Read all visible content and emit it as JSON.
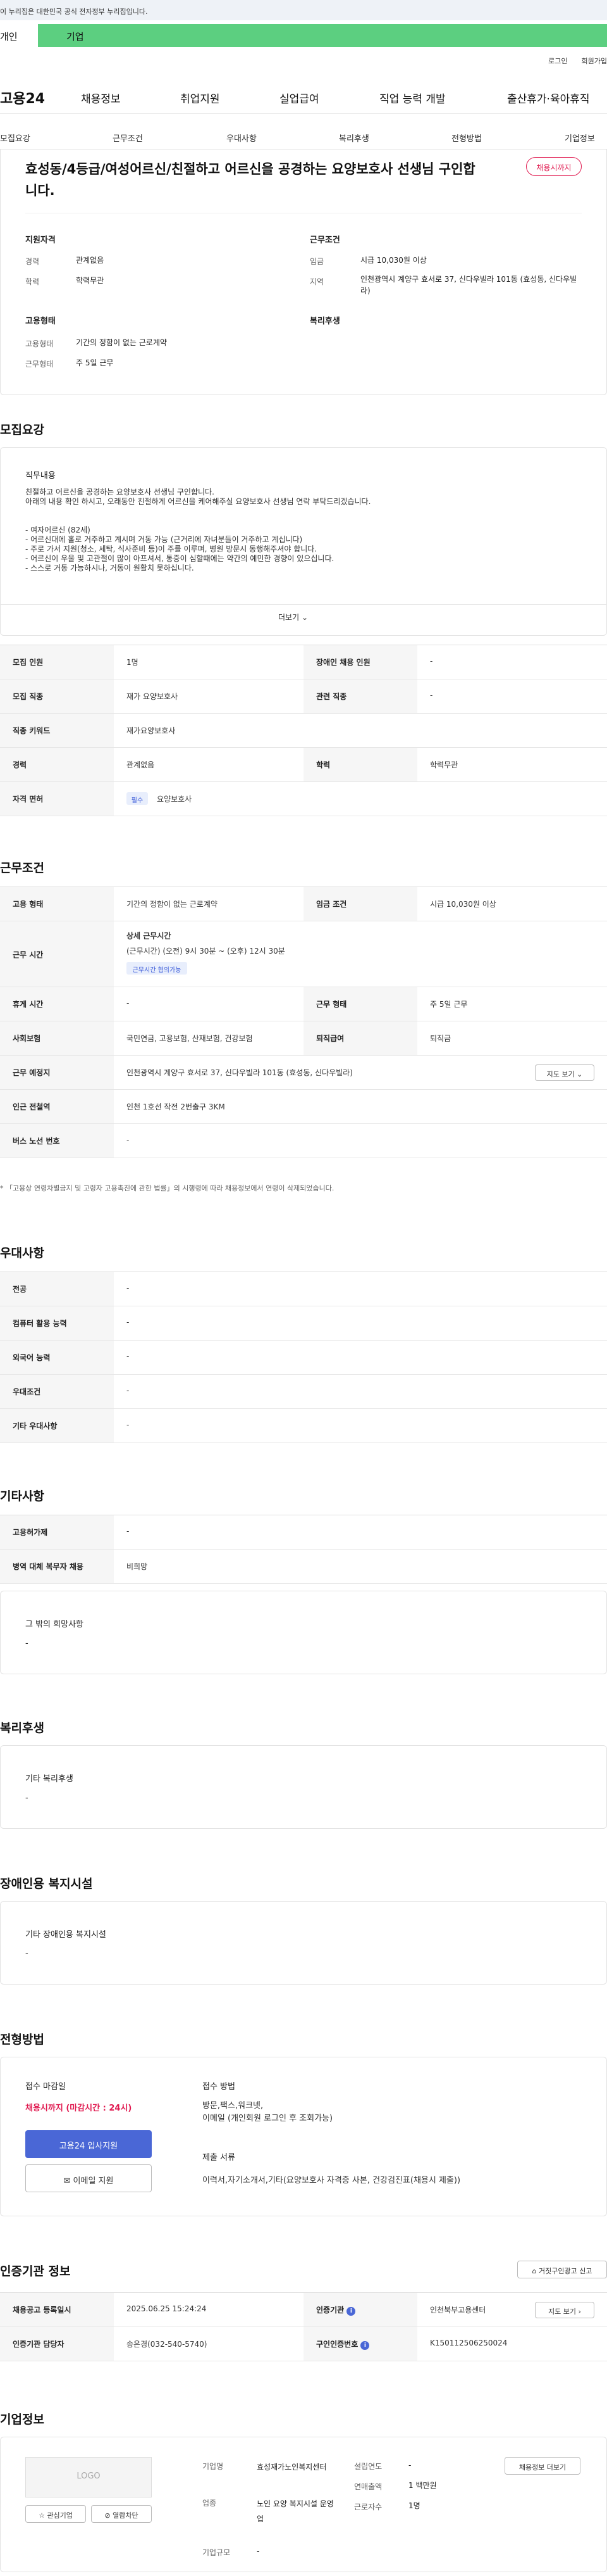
{
  "gov_bar": {
    "text": "이 누리집은 대한민국 공식 전자정부 누리집입니다."
  },
  "tabs": {
    "personal": "개인",
    "corporate": "기업"
  },
  "util": {
    "login": "로그인",
    "join": "회원가입"
  },
  "gnb": {
    "logo": "고용24",
    "menus": [
      "채용정보",
      "취업지원",
      "실업급여",
      "직업 능력 개발",
      "출산휴가·육아휴직"
    ]
  },
  "anchors": [
    "모집요강",
    "근무조건",
    "우대사항",
    "복리후생",
    "전형방법",
    "기업정보"
  ],
  "header": {
    "title": "효성동/4등급/여성어르신/친절하고 어르신을 공경하는 요양보호사 선생님 구인합니다.",
    "badge": "채용시까지",
    "qual_heading": "지원자격",
    "cond_heading": "근무조건",
    "emp_heading": "고용형태",
    "welfare_heading": "복리후생",
    "career_k": "경력",
    "career_v": "관계없음",
    "edu_k": "학력",
    "edu_v": "학력무관",
    "wage_k": "임금",
    "wage_v": "시급 10,030원 이상",
    "area_k": "지역",
    "area_v": "인천광역시 계양구 효서로 37, 신다우빌라 101동 (효성동, 신다우빌라)",
    "emptype_k": "고용형태",
    "emptype_v": "기간의 정함이 없는 근로계약",
    "worktype_k": "근무형태",
    "worktype_v": "주 5일 근무"
  },
  "recruit": {
    "title": "모집요강",
    "duty_heading": "직무내용",
    "duty_lines": [
      "친절하고 어르신을 공경하는 요양보호사 선생님 구인합니다.",
      "아래의 내용 확인 하시고, 오래동안 친절하게 어르신을 케어해주실 요양보호사 선생님 연락 부탁드리겠습니다.",
      "",
      "",
      "- 여자어르신 (82세)",
      "- 어르신대에 홀로 거주하고 계시며 거동 가능 (근거리에 자녀분들이 거주하고 계십니다)",
      "- 주로 가서 지원(청소, 세탁, 식사준비 등)이 주를 이루며, 병원 방문시 동행해주셔야 합니다.",
      "- 어르신이 우울 및 고관절이 많이 아프셔서, 통증이 심할때에는 약간의 예민한 경향이 있으십니다.",
      "- 스스로 거동 가능하시나, 거동이 원활치 못하십니다."
    ],
    "more": "더보기",
    "rows": [
      {
        "k1": "모집 인원",
        "v1": "1명",
        "k2": "장애인 채용 인원",
        "v2": "-"
      },
      {
        "k1": "모집 직종",
        "v1": "재가 요양보호사",
        "k2": "관련 직종",
        "v2": "-"
      },
      {
        "k1": "직종 키워드",
        "v1": "재가요양보호사"
      },
      {
        "k1": "경력",
        "v1": "관계없음",
        "k2": "학력",
        "v2": "학력무관"
      },
      {
        "k1": "자격 면허",
        "tag": "필수",
        "v1": "요양보호사"
      }
    ]
  },
  "conditions": {
    "title": "근무조건",
    "emp_k": "고용 형태",
    "emp_v": "기간의 정함이 없는 근로계약",
    "wage_k": "임금 조건",
    "wage_v": "시급 10,030원 이상",
    "time_k": "근무 시간",
    "time_heading": "상세 근무시간",
    "time_v": "(근무시간) (오전) 9시 30분 ~ (오후) 12시 30분",
    "time_tag": "근무시간 협의가능",
    "break_k": "휴게 시간",
    "break_v": "-",
    "shift_k": "근무 형태",
    "shift_v": "주 5일 근무",
    "ins_k": "사회보험",
    "ins_v": "국민연금, 고용보험, 산재보험, 건강보험",
    "sev_k": "퇴직급여",
    "sev_v": "퇴직금",
    "loc_k": "근무 예정지",
    "loc_v": "인천광역시 계양구 효서로 37, 신다우빌라 101동 (효성동, 신다우빌라)",
    "map_btn": "지도 보기",
    "sub_k": "인근 전철역",
    "sub_v": "인천 1호선 작전 2번출구 3KM",
    "bus_k": "버스 노선 번호",
    "bus_v": "-",
    "note": "「고용상 연령차별금지 및 고령자 고용촉진에 관한 법률」의 시행령에 따라 채용정보에서 연령이 삭제되었습니다."
  },
  "preferences": {
    "title": "우대사항",
    "rows": [
      {
        "k": "전공",
        "v": "-"
      },
      {
        "k": "컴퓨터 활용 능력",
        "v": "-"
      },
      {
        "k": "외국어 능력",
        "v": "-"
      },
      {
        "k": "우대조건",
        "v": "-"
      },
      {
        "k": "기타 우대사항",
        "v": "-"
      }
    ]
  },
  "other": {
    "title": "기타사항",
    "rows": [
      {
        "k": "고용허가제",
        "v": "-"
      },
      {
        "k": "병역 대체 복무자 채용",
        "v": "비희망"
      }
    ],
    "box_heading": "그 밖의 희망사항",
    "box_v": "-"
  },
  "welfare": {
    "title": "복리후생",
    "box_heading": "기타 복리후생",
    "box_v": "-"
  },
  "disabled": {
    "title": "장애인용 복지시설",
    "box_heading": "기타 장애인용 복지시설",
    "box_v": "-"
  },
  "process": {
    "title": "전형방법",
    "deadline_heading": "접수 마감일",
    "deadline_v": "채용시까지 (마감시간 : 24시)",
    "apply_btn": "고용24 입사지원",
    "email_btn": "이메일 지원",
    "method_heading": "접수 방법",
    "method_v": "방문,팩스,워크넷,",
    "method_v2": "이메일 (개인회원 로그인 후 조회가능)",
    "docs_heading": "제출 서류",
    "docs_v": "이력서,자기소개서,기타(요양보호사 자격증 사본, 건강검진표(채용시 제출))"
  },
  "cert": {
    "title": "인증기관 정보",
    "report_btn": "거짓구인광고 신고",
    "reg_k": "채용공고 등록일시",
    "reg_v": "2025.06.25 15:24:24",
    "org_k": "인증기관",
    "org_v": "인천북부고용센터",
    "map_btn": "지도 보기",
    "mgr_k": "인증기관 담당자",
    "mgr_v": "송은경(032-540-5740)",
    "no_k": "구인인증번호",
    "no_v": "K150112506250024"
  },
  "company": {
    "title": "기업정보",
    "logo": "LOGO",
    "interest_btn": "관심기업",
    "block_btn": "열람차단",
    "jobs_btn": "채용정보 더보기",
    "name_k": "기업명",
    "name_v": "효성재가노인복지센터",
    "year_k": "설립연도",
    "year_v": "-",
    "ind_k": "업종",
    "ind_v": "노인 요양 복지시설 운영업",
    "sales_k": "연매출액",
    "sales_v": "1 백만원",
    "staff_k": "근로자수",
    "staff_v": "1명",
    "size_k": "기업규모",
    "size_v": "-"
  }
}
